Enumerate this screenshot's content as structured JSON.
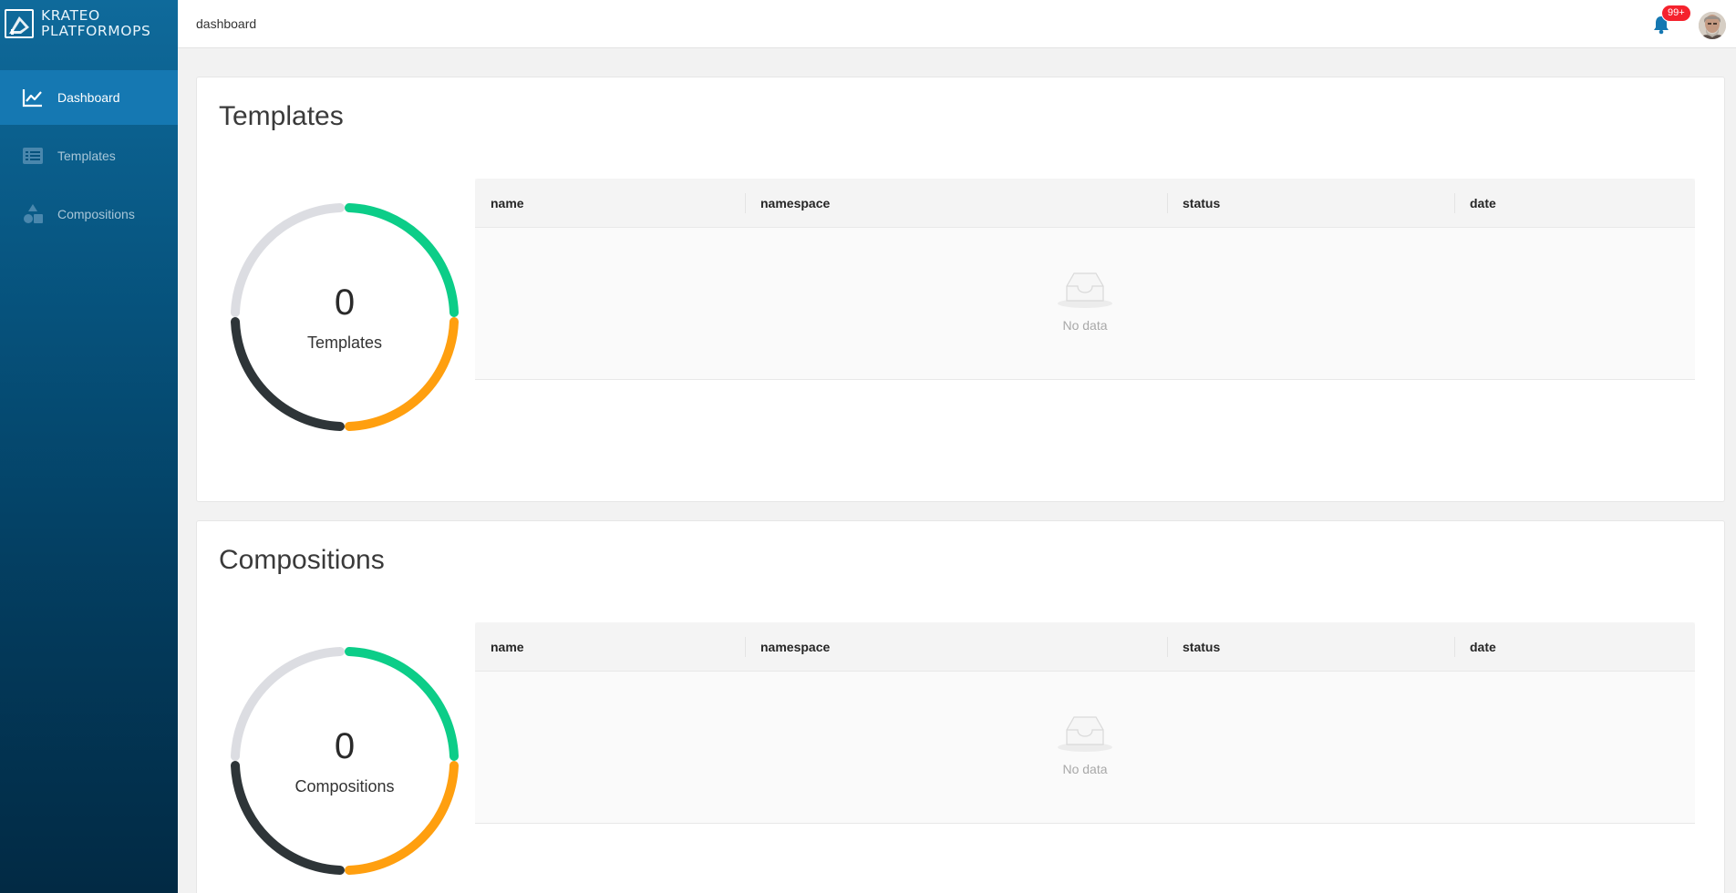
{
  "app": {
    "logo_line1": "KRATEO",
    "logo_line2": "PLATFORMOPS"
  },
  "sidebar": {
    "items": [
      {
        "label": "Dashboard",
        "icon": "line-chart-icon",
        "active": true
      },
      {
        "label": "Templates",
        "icon": "list-icon",
        "active": false
      },
      {
        "label": "Compositions",
        "icon": "shapes-icon",
        "active": false
      }
    ]
  },
  "header": {
    "breadcrumb": "dashboard",
    "notification_badge": "99+"
  },
  "templates": {
    "title": "Templates",
    "count": "0",
    "count_label": "Templates",
    "columns": [
      "name",
      "namespace",
      "status",
      "date"
    ],
    "empty_text": "No data"
  },
  "compositions": {
    "title": "Compositions",
    "count": "0",
    "count_label": "Compositions",
    "columns": [
      "name",
      "namespace",
      "status",
      "date"
    ],
    "empty_text": "No data"
  },
  "colors": {
    "ring_green": "#0ccd88",
    "ring_orange": "#ff9f0f",
    "ring_dark": "#2e3538",
    "ring_gray": "#dcdde2",
    "sidebar_active": "#1578b2",
    "badge_red": "#f5222d"
  }
}
